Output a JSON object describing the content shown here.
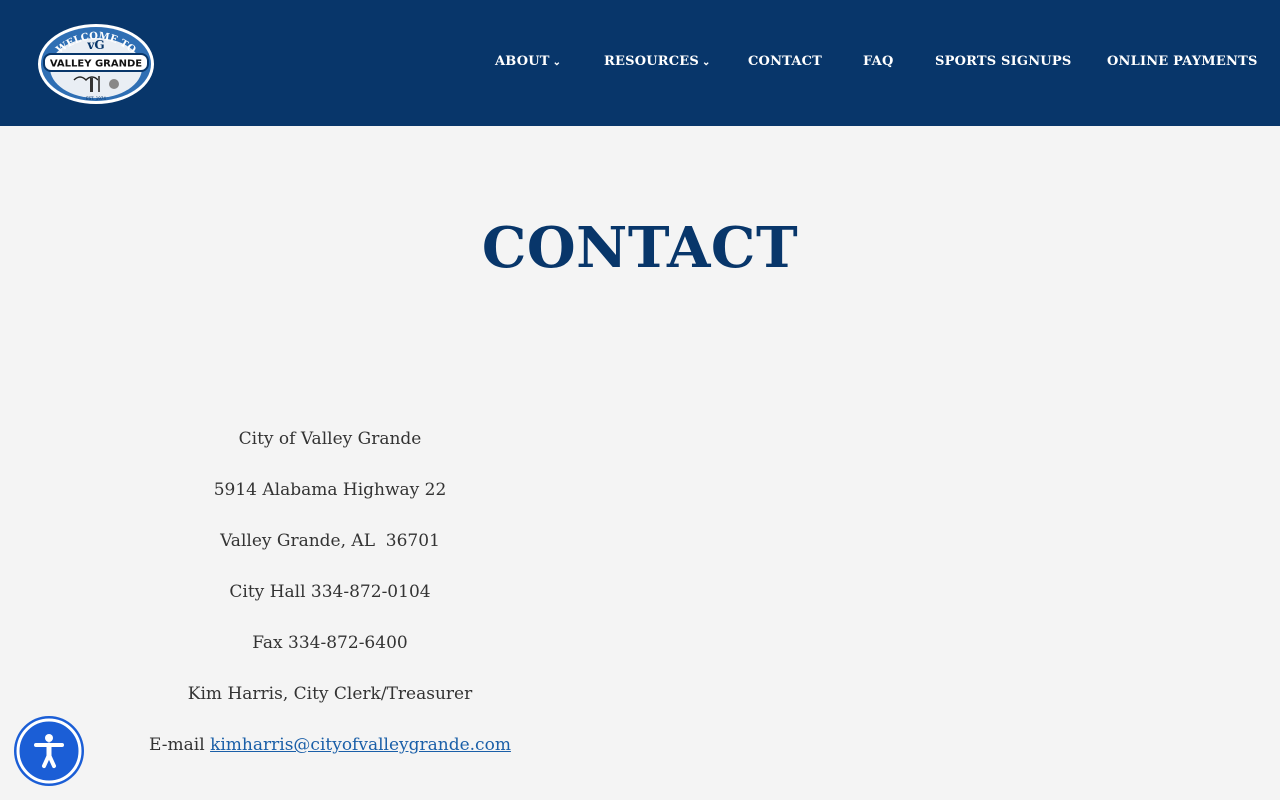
{
  "header": {
    "logo": {
      "top_text": "WELCOME TO",
      "monogram": "vG",
      "banner_text": "VALLEY GRANDE",
      "bottom_text": "EST. 1974"
    },
    "nav": [
      {
        "label": "ABOUT",
        "has_dropdown": true
      },
      {
        "label": "RESOURCES",
        "has_dropdown": true
      },
      {
        "label": "CONTACT",
        "has_dropdown": false
      },
      {
        "label": "FAQ",
        "has_dropdown": false
      },
      {
        "label": "SPORTS SIGNUPS",
        "has_dropdown": false
      },
      {
        "label": "ONLINE PAYMENTS",
        "has_dropdown": false
      }
    ],
    "chevron": "⌄"
  },
  "main": {
    "title": "CONTACT",
    "contact": {
      "city": "City of Valley Grande",
      "street": "5914 Alabama Highway 22",
      "city_state_zip": "Valley Grande, AL  36701",
      "city_hall": "City Hall 334-872-0104",
      "fax": "Fax 334-872-6400",
      "clerk": "Kim Harris, City Clerk/Treasurer",
      "email_label": "E-mail ",
      "email": "kimharris@cityofvalleygrande.com"
    }
  },
  "accessibility_button": {
    "icon": "accessibility-icon"
  },
  "colors": {
    "header_bg": "#08366a",
    "title": "#08366a",
    "link": "#1a5fa8",
    "a11y": "#1b5ed6",
    "page_bg": "#f4f4f4"
  }
}
